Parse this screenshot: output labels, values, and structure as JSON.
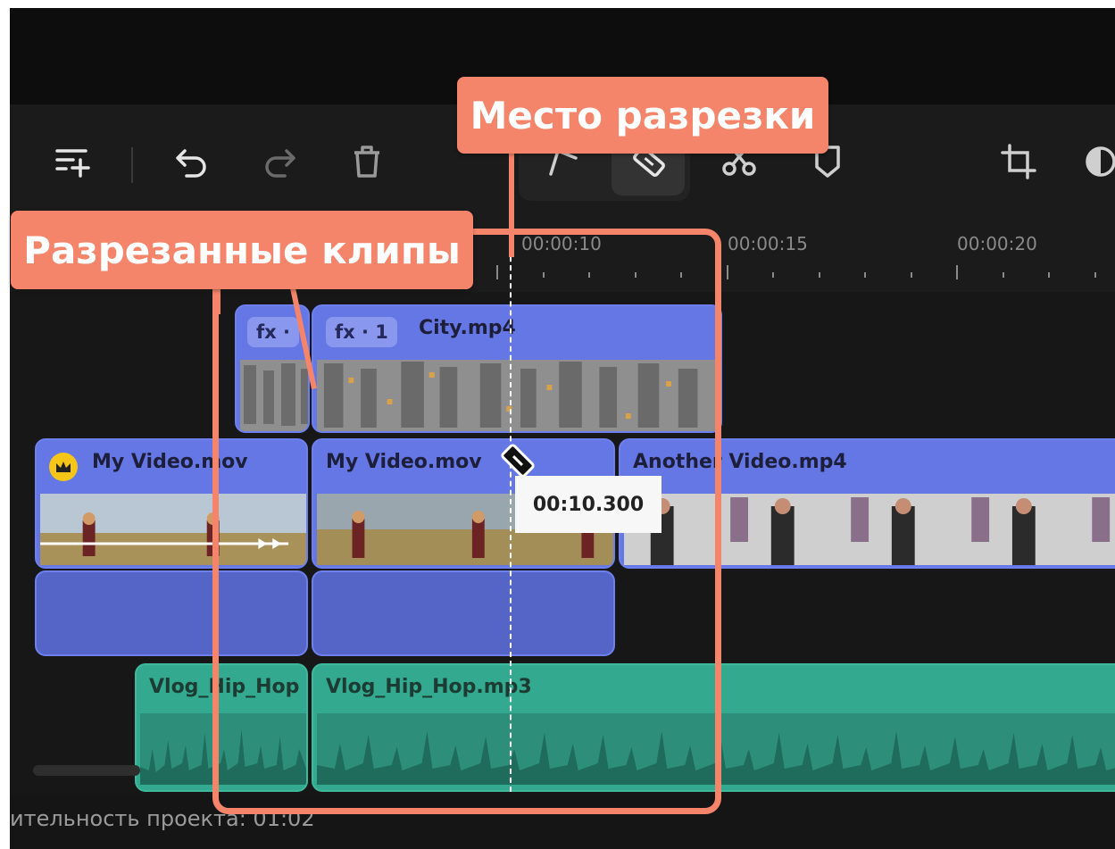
{
  "toolbar": {
    "icons": [
      "add-track-icon",
      "undo-icon",
      "redo-icon",
      "delete-icon",
      "pen-tool-icon",
      "blade-icon",
      "scissors-icon",
      "marker-icon",
      "crop-icon",
      "color-icon"
    ],
    "active_tool": "blade-icon"
  },
  "ruler": {
    "labels": [
      "00:00:10",
      "00:00:15",
      "00:00:20"
    ]
  },
  "clips": {
    "city_left": {
      "fx": "fx ·"
    },
    "city_right": {
      "fx": "fx · 1",
      "name": "City.mp4"
    },
    "video_left": {
      "name": "My Video.mov"
    },
    "video_right": {
      "name": "My Video.mov"
    },
    "video_another": {
      "name": "Another Video.mp4"
    },
    "audio_left": {
      "name": "Vlog_Hip_Hop"
    },
    "audio_right": {
      "name": "Vlog_Hip_Hop.mp3"
    }
  },
  "playhead": {
    "time": "00:10.300"
  },
  "status": {
    "text": "ительность проекта: 01:02"
  },
  "callouts": {
    "cut_point": "Место разрезки",
    "split_clips": "Разрезанные клипы"
  },
  "colors": {
    "accent_callout": "#f4856a",
    "video_clip": "#6577e5",
    "audio_clip": "#33a98f",
    "premium_badge": "#f5c518"
  }
}
